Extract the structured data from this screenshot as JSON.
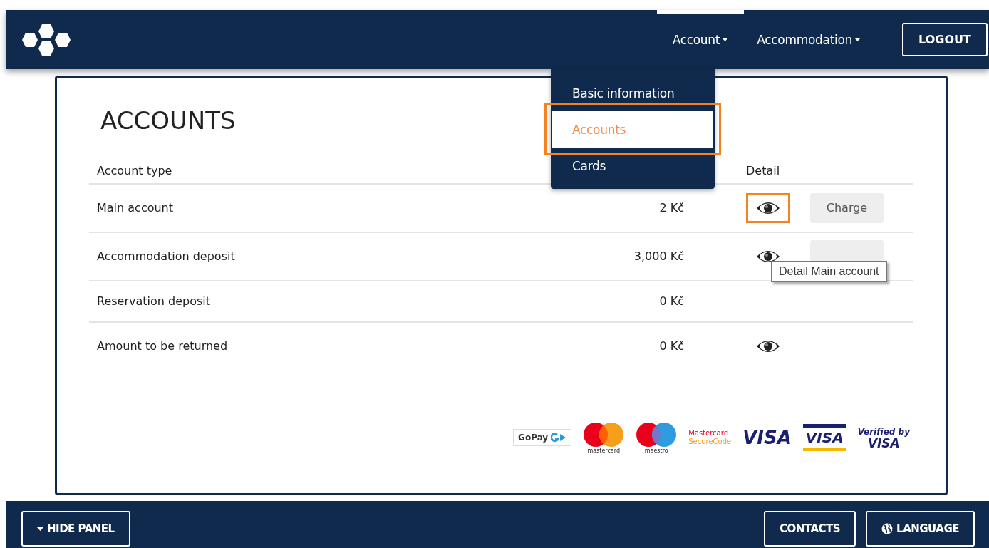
{
  "navbar": {
    "menus": [
      {
        "label": "Account",
        "expanded": true
      },
      {
        "label": "Accommodation",
        "expanded": false
      }
    ],
    "logout": "LOGOUT"
  },
  "dropdown": {
    "items": [
      {
        "label": "Basic information",
        "selected": false
      },
      {
        "label": "Accounts",
        "selected": true
      },
      {
        "label": "Cards",
        "selected": false
      }
    ]
  },
  "page_title": "ACCOUNTS",
  "table": {
    "columns": [
      "Account type",
      "Detail"
    ],
    "rows": [
      {
        "account_type": "Main account",
        "balance": "2 Kč",
        "detail": true,
        "highlighted": true,
        "charge": true,
        "charge_label": "Charge"
      },
      {
        "account_type": "Accommodation deposit",
        "balance": "3,000 Kč",
        "detail": true,
        "highlighted": false,
        "charge": true
      },
      {
        "account_type": "Reservation deposit",
        "balance": "0 Kč",
        "detail": false,
        "charge": false
      },
      {
        "account_type": "Amount to be returned",
        "balance": "0 Kč",
        "detail": true,
        "highlighted": false,
        "charge": false
      }
    ]
  },
  "tooltip": "Detail Main account",
  "payment_logos": [
    {
      "kind": "gopay",
      "text": "GoPay"
    },
    {
      "kind": "mastercard",
      "text": "mastercard"
    },
    {
      "kind": "maestro",
      "text": "maestro"
    },
    {
      "kind": "securecode",
      "text": "Mastercard",
      "text2": "SecureCode"
    },
    {
      "kind": "visa",
      "text": "VISA"
    },
    {
      "kind": "visa_electron",
      "text": "VISA"
    },
    {
      "kind": "verified_visa",
      "text": "Verified by",
      "text2": "VISA"
    }
  ],
  "footer": {
    "hide_panel": "HIDE PANEL",
    "contacts": "CONTACTS",
    "language": "LANGUAGE"
  }
}
